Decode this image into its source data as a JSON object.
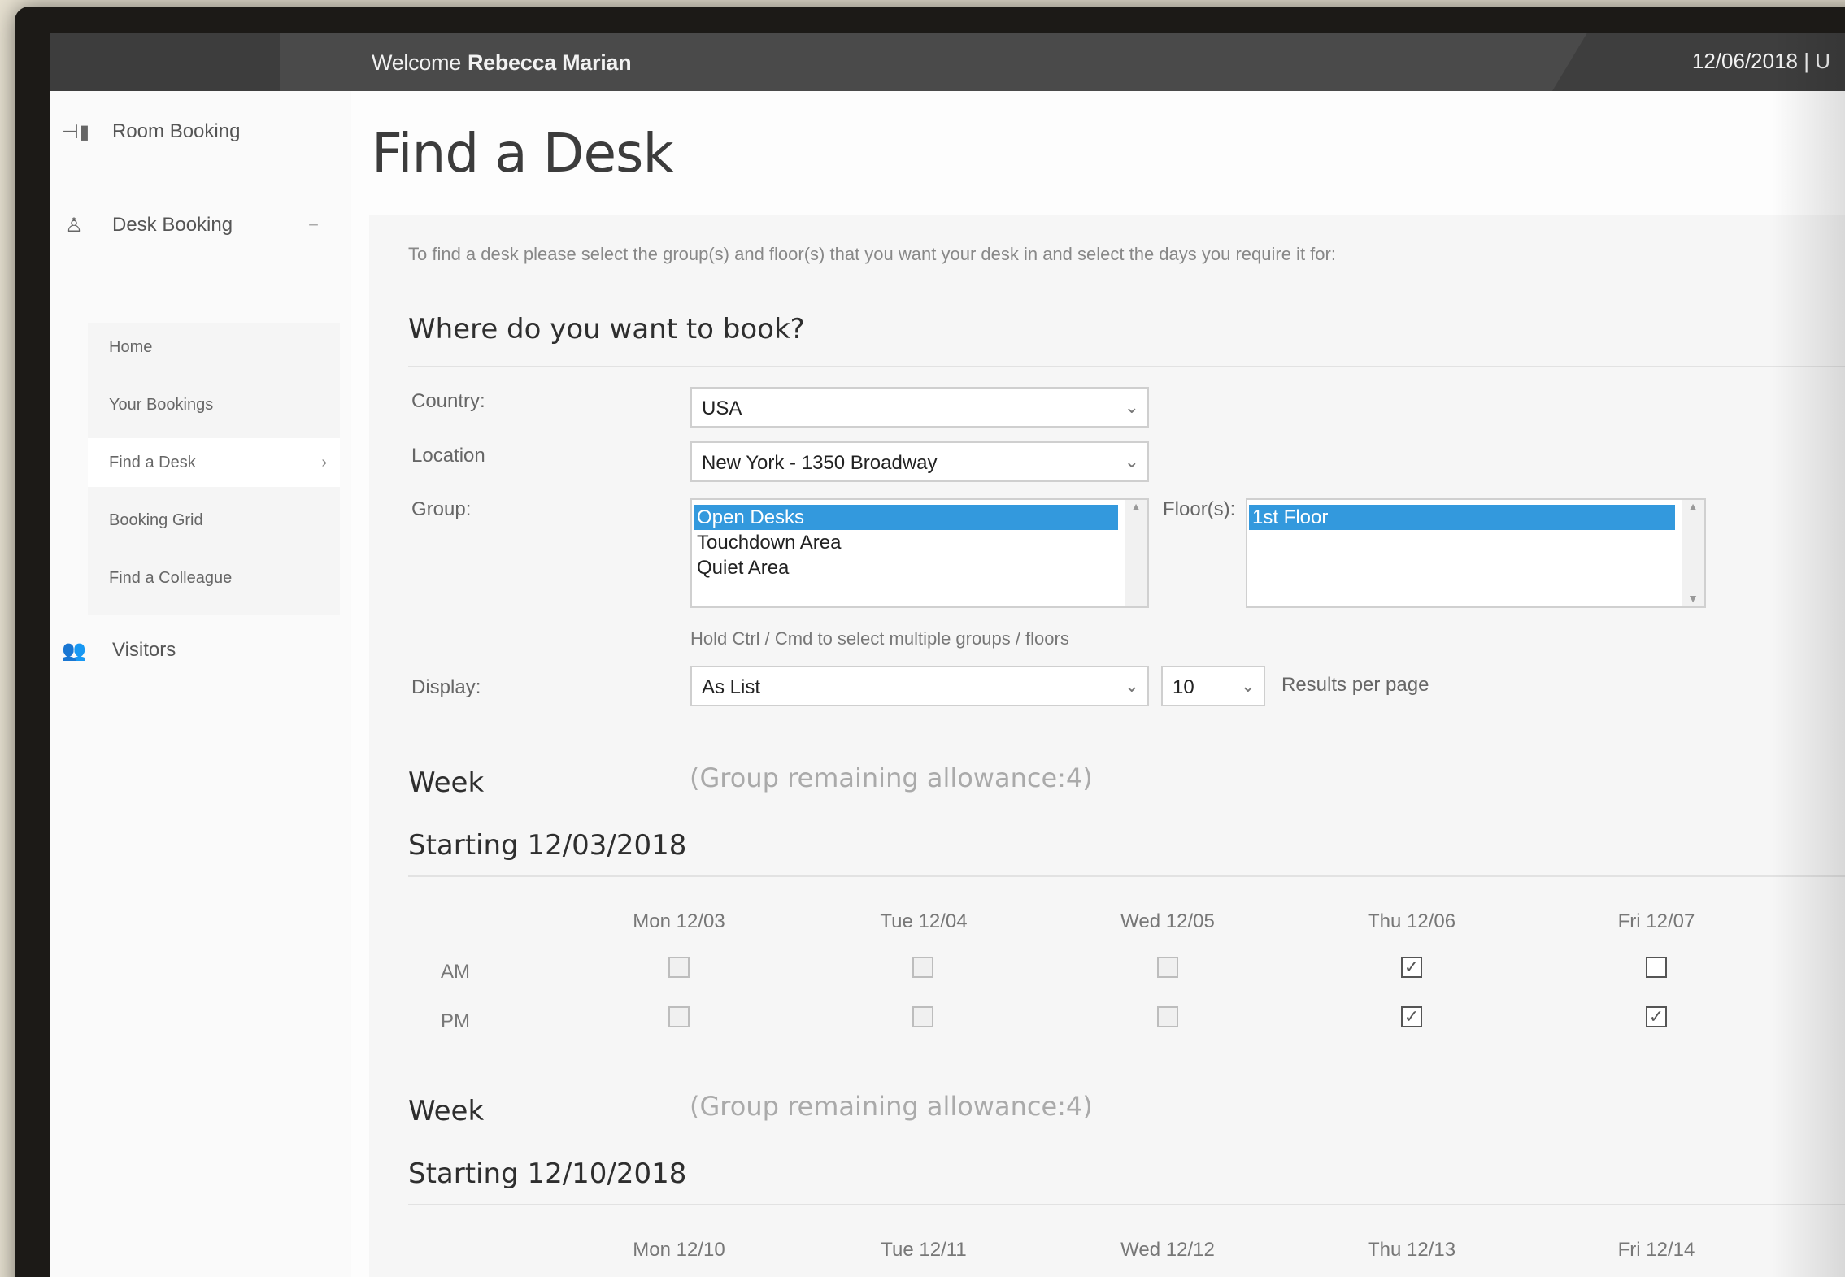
{
  "header": {
    "welcome_prefix": "Welcome",
    "user_name": "Rebecca Marian",
    "date": "12/06/2018 | U"
  },
  "sidebar": {
    "items": [
      {
        "label": "Room Booking",
        "icon": "door-icon"
      },
      {
        "label": "Desk Booking",
        "icon": "person-icon",
        "toggle": "−"
      },
      {
        "label": "Visitors",
        "icon": "people-icon"
      }
    ],
    "sub_items": [
      {
        "label": "Home"
      },
      {
        "label": "Your Bookings"
      },
      {
        "label": "Find a Desk",
        "active": true
      },
      {
        "label": "Booking Grid"
      },
      {
        "label": "Find a Colleague"
      }
    ]
  },
  "page": {
    "title": "Find a Desk",
    "intro": "To find a desk please select the group(s) and floor(s) that you want your desk in and select the days you require it for:",
    "section_heading": "Where do you want to book?"
  },
  "form": {
    "country_label": "Country:",
    "country_value": "USA",
    "location_label": "Location",
    "location_value": "New York - 1350 Broadway",
    "group_label": "Group:",
    "groups": [
      {
        "label": "Open Desks",
        "selected": true
      },
      {
        "label": "Touchdown Area",
        "selected": false
      },
      {
        "label": "Quiet Area",
        "selected": false
      }
    ],
    "floor_label": "Floor(s):",
    "floors": [
      {
        "label": "1st Floor",
        "selected": true
      }
    ],
    "hint": "Hold Ctrl / Cmd to select multiple groups / floors",
    "display_label": "Display:",
    "display_value": "As List",
    "per_page_value": "10",
    "per_page_label": "Results per page"
  },
  "weeks": [
    {
      "title": "Week",
      "allowance": "(Group remaining allowance:4)",
      "starting": "Starting 12/03/2018",
      "days": [
        "Mon 12/03",
        "Tue 12/04",
        "Wed 12/05",
        "Thu 12/06",
        "Fri 12/07"
      ],
      "am_label": "AM",
      "pm_label": "PM",
      "am": [
        {
          "checked": false,
          "enabled": false
        },
        {
          "checked": false,
          "enabled": false
        },
        {
          "checked": false,
          "enabled": false
        },
        {
          "checked": true,
          "enabled": true
        },
        {
          "checked": false,
          "enabled": true
        }
      ],
      "pm": [
        {
          "checked": false,
          "enabled": false
        },
        {
          "checked": false,
          "enabled": false
        },
        {
          "checked": false,
          "enabled": false
        },
        {
          "checked": true,
          "enabled": true
        },
        {
          "checked": true,
          "enabled": true
        }
      ]
    },
    {
      "title": "Week",
      "allowance": "(Group remaining allowance:4)",
      "starting": "Starting 12/10/2018",
      "days": [
        "Mon 12/10",
        "Tue 12/11",
        "Wed 12/12",
        "Thu 12/13",
        "Fri 12/14"
      ]
    }
  ],
  "colors": {
    "topbar": "#4a4a4a",
    "selection": "#3399dd"
  }
}
